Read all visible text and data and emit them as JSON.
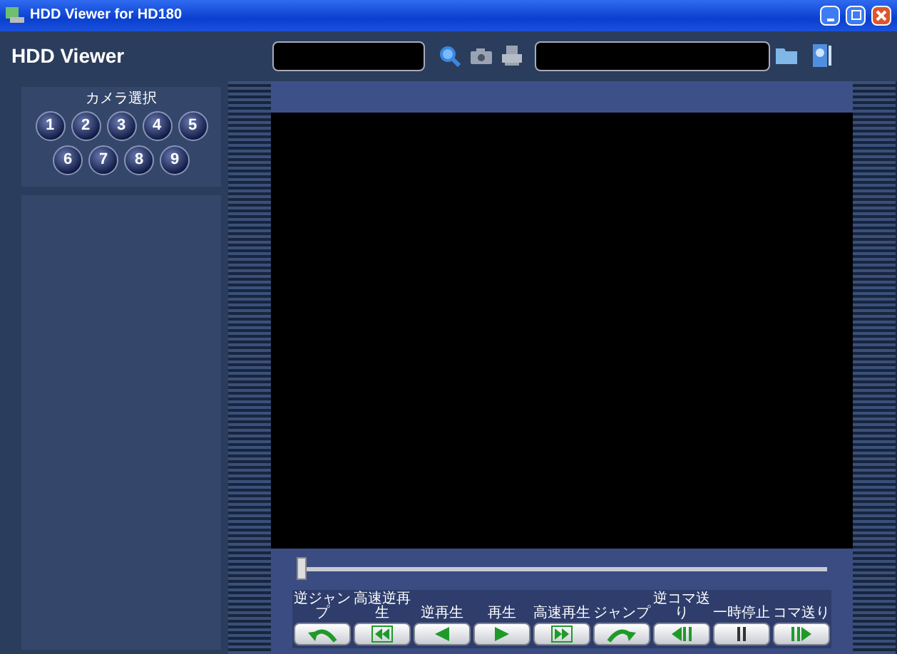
{
  "window": {
    "title": "HDD Viewer for HD180"
  },
  "header": {
    "app_name": "HDD Viewer"
  },
  "camera_select": {
    "label": "カメラ選択",
    "cameras": [
      {
        "number": "1"
      },
      {
        "number": "2"
      },
      {
        "number": "3"
      },
      {
        "number": "4"
      },
      {
        "number": "5"
      },
      {
        "number": "6"
      },
      {
        "number": "7"
      },
      {
        "number": "8"
      },
      {
        "number": "9"
      }
    ]
  },
  "playback": {
    "position": {
      "level": 0.0
    },
    "controls": [
      {
        "label": "逆ジャンプ",
        "kind": "jump-back"
      },
      {
        "label": "高速逆再生",
        "kind": "fast-reverse"
      },
      {
        "label": "逆再生",
        "kind": "reverse"
      },
      {
        "label": "再生",
        "kind": "play"
      },
      {
        "label": "高速再生",
        "kind": "fast-forward"
      },
      {
        "label": "ジャンプ",
        "kind": "jump"
      },
      {
        "label": "逆コマ送り",
        "kind": "step-back"
      },
      {
        "label": "一時停止",
        "kind": "pause"
      },
      {
        "label": "コマ送り",
        "kind": "step"
      }
    ]
  }
}
